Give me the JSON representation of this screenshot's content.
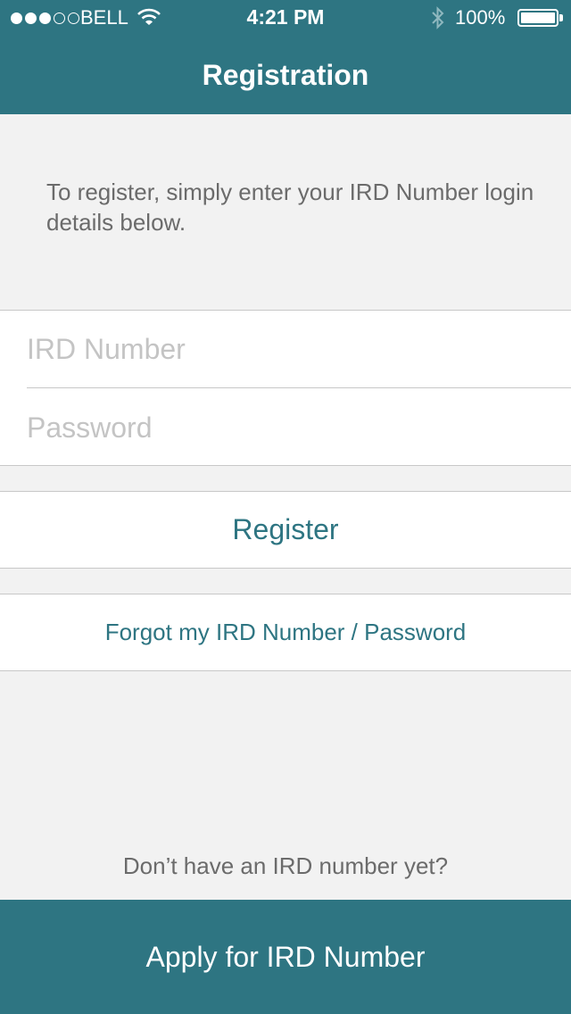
{
  "status_bar": {
    "signal_bars": 3,
    "signal_total": 5,
    "carrier": "BELL",
    "time": "4:21 PM",
    "battery_percent": "100%",
    "icons": [
      "signal-dots-icon",
      "wifi-icon",
      "bluetooth-icon",
      "battery-icon"
    ]
  },
  "nav": {
    "title": "Registration"
  },
  "intro_text": "To register, simply enter your IRD Number login details below.",
  "form": {
    "ird_placeholder": "IRD Number",
    "ird_value": "",
    "password_placeholder": "Password",
    "password_value": ""
  },
  "buttons": {
    "register_label": "Register",
    "forgot_label": "Forgot my IRD Number / Password",
    "apply_label": "Apply for IRD Number"
  },
  "footer_prompt": "Don’t have an IRD number yet?",
  "colors": {
    "accent": "#2e7582",
    "background": "#f2f2f2",
    "body_text": "#6b6b6b",
    "placeholder": "#c4c4c4",
    "separator": "#c8c8c8"
  }
}
